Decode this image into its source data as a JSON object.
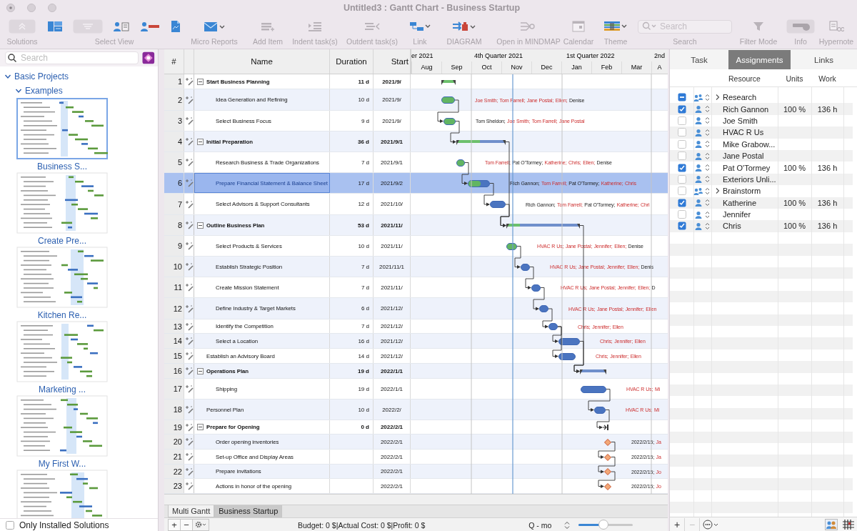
{
  "window": {
    "title": "Untitled3 : Gantt Chart - Business Startup"
  },
  "toolbar": [
    {
      "kind": "solutions",
      "label": "Solutions"
    },
    {
      "kind": "views",
      "label": "Select View"
    },
    {
      "kind": "reports",
      "label": "Micro Reports"
    },
    {
      "kind": "add",
      "label": "Add Item"
    },
    {
      "kind": "indent",
      "label": "Indent task(s)"
    },
    {
      "kind": "outdent",
      "label": "Outdent task(s)"
    },
    {
      "kind": "link",
      "label": "Link"
    },
    {
      "kind": "diagram",
      "label": "DIAGRAM"
    },
    {
      "kind": "mindmap",
      "label": "Open in MINDMAP"
    },
    {
      "kind": "calendar",
      "label": "Calendar"
    },
    {
      "kind": "theme",
      "label": "Theme"
    },
    {
      "kind": "search",
      "label": "Search",
      "placeholder": "Search"
    },
    {
      "kind": "filter",
      "label": "Filter Mode"
    },
    {
      "kind": "info",
      "label": "Info"
    },
    {
      "kind": "hypernote",
      "label": "Hypernote"
    }
  ],
  "sidebar": {
    "search": {
      "placeholder": "Search"
    },
    "tree": [
      {
        "label": "Basic Projects",
        "expanded": true,
        "children": [
          {
            "label": "Examples",
            "expanded": true
          }
        ]
      }
    ],
    "solutions": [
      {
        "label": "Business S...",
        "selected": true
      },
      {
        "label": "Create Pre...",
        "selected": false
      },
      {
        "label": "Kitchen Re...",
        "selected": false
      },
      {
        "label": "Marketing ...",
        "selected": false
      },
      {
        "label": "My First W...",
        "selected": false
      },
      {
        "selected": false
      }
    ],
    "only_installed": {
      "label": "Only Installed Solutions",
      "checked": false
    }
  },
  "gantt": {
    "columns": [
      "#",
      "Name",
      "Duration",
      "Start"
    ],
    "timeline": {
      "quarters": [
        "er 2021",
        "4th Quarter 2021",
        "1st Quarter 2022",
        "2nd"
      ],
      "months": [
        "Aug",
        "Sep",
        "Oct",
        "Nov",
        "Dec",
        "Jan",
        "Feb",
        "Mar",
        "A"
      ]
    },
    "rows": [
      {
        "num": "1",
        "name": "Start Business Planning",
        "kind": "summary",
        "expanded": true,
        "duration": "11 d",
        "start": "2021/9/",
        "level": 1,
        "selected": false,
        "children": [
          {
            "num": "2",
            "name": "Idea Generation and Refining",
            "kind": "task",
            "duration": "10 d",
            "start": "2021/9/",
            "level": 1,
            "selected": false,
            "resources": [
              {
                "name": "Joe Smith;",
                "overallocated": true
              },
              {
                "name": "Tom Farrell;",
                "overallocated": true
              },
              {
                "name": "Jane Postal;",
                "overallocated": true
              },
              {
                "name": "Ellen;",
                "overallocated": true
              },
              {
                "name": "Denise",
                "overallocated": false
              }
            ]
          },
          {
            "num": "3",
            "name": "Select Business Focus",
            "kind": "task",
            "duration": "9 d",
            "start": "2021/9/",
            "level": 1,
            "selected": false,
            "resources": [
              {
                "name": "Tom Sheldon;",
                "overallocated": false
              },
              {
                "name": "Joe Smith;",
                "overallocated": true
              },
              {
                "name": "Tom Farrell;",
                "overallocated": true
              },
              {
                "name": "Jane Postal",
                "overallocated": true
              }
            ]
          }
        ]
      },
      {
        "num": "4",
        "name": "Initial Preparation",
        "kind": "summary",
        "expanded": true,
        "duration": "36 d",
        "start": "2021/9/1",
        "level": 0.48,
        "selected": false,
        "children": [
          {
            "num": "5",
            "name": "Research Business & Trade Organizations",
            "kind": "task",
            "duration": "7 d",
            "start": "2021/9/1",
            "level": 1,
            "selected": false,
            "resources": [
              {
                "name": "Tom Farrell;",
                "overallocated": true
              },
              {
                "name": "Pat O'Tormey;",
                "overallocated": false
              },
              {
                "name": "Katherine;",
                "overallocated": true
              },
              {
                "name": "Chris;",
                "overallocated": true
              },
              {
                "name": "Ellen;",
                "overallocated": true
              },
              {
                "name": "Denise",
                "overallocated": false
              }
            ]
          },
          {
            "num": "6",
            "name": "Prepare Financial Statement & Balance Sheet",
            "kind": "task",
            "duration": "17 d",
            "start": "2021/9/2",
            "level": 0.6,
            "selected": true,
            "resources": [
              {
                "name": "Rich Gannon;",
                "overallocated": false
              },
              {
                "name": "Tom Farrell;",
                "overallocated": true
              },
              {
                "name": "Pat O'Tormey;",
                "overallocated": false
              },
              {
                "name": "Katherine;",
                "overallocated": true
              },
              {
                "name": "Chris",
                "overallocated": true
              }
            ]
          },
          {
            "num": "7",
            "name": "Select Advisors & Support Consultants",
            "kind": "task",
            "duration": "12 d",
            "start": "2021/10/",
            "level": 0,
            "selected": false,
            "resources": [
              {
                "name": "Rich Gannon;",
                "overallocated": false
              },
              {
                "name": "Tom Farrell;",
                "overallocated": true
              },
              {
                "name": "Pat O'Tormey;",
                "overallocated": false
              },
              {
                "name": "Katherine;",
                "overallocated": true
              },
              {
                "name": "Chri",
                "overallocated": true
              }
            ]
          }
        ]
      },
      {
        "num": "8",
        "name": "Outline Business Plan",
        "kind": "summary",
        "expanded": true,
        "duration": "53 d",
        "start": "2021/11/",
        "level": 0.18,
        "selected": false,
        "children": [
          {
            "num": "9",
            "name": "Select Products & Services",
            "kind": "task",
            "duration": "10 d",
            "start": "2021/11/",
            "level": 1,
            "selected": false,
            "resources": [
              {
                "name": "HVAC R Us;",
                "overallocated": true
              },
              {
                "name": "Jane Postal;",
                "overallocated": true
              },
              {
                "name": "Jennifer;",
                "overallocated": true
              },
              {
                "name": "Ellen;",
                "overallocated": true
              },
              {
                "name": "Denise",
                "overallocated": false
              }
            ]
          },
          {
            "num": "10",
            "name": "Establish Strategic Position",
            "kind": "task",
            "duration": "7 d",
            "start": "2021/11/1",
            "level": 0,
            "selected": false,
            "resources": [
              {
                "name": "HVAC R Us;",
                "overallocated": true
              },
              {
                "name": "Jane Postal;",
                "overallocated": true
              },
              {
                "name": "Jennifer;",
                "overallocated": true
              },
              {
                "name": "Ellen;",
                "overallocated": true
              },
              {
                "name": "Denis",
                "overallocated": false
              }
            ]
          },
          {
            "num": "11",
            "name": "Create Mission Statement",
            "kind": "task",
            "duration": "7 d",
            "start": "2021/11/",
            "level": 0,
            "selected": false,
            "resources": [
              {
                "name": "HVAC R Us;",
                "overallocated": true
              },
              {
                "name": "Jane Postal;",
                "overallocated": true
              },
              {
                "name": "Jennifer;",
                "overallocated": true
              },
              {
                "name": "Ellen;",
                "overallocated": true
              },
              {
                "name": "D",
                "overallocated": false
              }
            ]
          },
          {
            "num": "12",
            "name": "Define Industry & Target Markets",
            "kind": "task",
            "duration": "6 d",
            "start": "2021/12/",
            "level": 0,
            "selected": false,
            "resources": [
              {
                "name": "HVAC R Us;",
                "overallocated": true
              },
              {
                "name": "Jane Postal;",
                "overallocated": true
              },
              {
                "name": "Jennifer;",
                "overallocated": true
              },
              {
                "name": "Ellen",
                "overallocated": true
              }
            ]
          },
          {
            "num": "13",
            "name": "Identify the Competition",
            "kind": "task",
            "duration": "7 d",
            "start": "2021/12/",
            "level": 0,
            "selected": false,
            "resources": [
              {
                "name": "Chris;",
                "overallocated": true
              },
              {
                "name": "Jennifer;",
                "overallocated": true
              },
              {
                "name": "Ellen",
                "overallocated": true
              }
            ]
          },
          {
            "num": "14",
            "name": "Select a Location",
            "kind": "task",
            "duration": "16 d",
            "start": "2021/12/",
            "level": 0,
            "selected": false,
            "resources": [
              {
                "name": "Chris;",
                "overallocated": true
              },
              {
                "name": "Jennifer;",
                "overallocated": true
              },
              {
                "name": "Ellen",
                "overallocated": true
              }
            ]
          }
        ]
      },
      {
        "num": "15",
        "name": "Establish an Advisory Board",
        "kind": "task",
        "duration": "14 d",
        "start": "2021/12/",
        "level": 0,
        "selected": false,
        "resources": [
          {
            "name": "Chris;",
            "overallocated": true
          },
          {
            "name": "Jennifer;",
            "overallocated": true
          },
          {
            "name": "Ellen",
            "overallocated": true
          }
        ]
      },
      {
        "num": "16",
        "name": "Operations Plan",
        "kind": "summary",
        "expanded": true,
        "duration": "19 d",
        "start": "2022/1/1",
        "level": 0,
        "selected": false,
        "children": [
          {
            "num": "17",
            "name": "Shipping",
            "kind": "task",
            "duration": "19 d",
            "start": "2022/1/1",
            "level": 0,
            "selected": false,
            "resources": [
              {
                "name": "HVAC R Us;",
                "overallocated": true
              },
              {
                "name": "Mi",
                "overallocated": true
              }
            ]
          }
        ]
      },
      {
        "num": "18",
        "name": "Personnel Plan",
        "kind": "task",
        "duration": "10 d",
        "start": "2022/2/",
        "level": 0,
        "selected": false,
        "resources": [
          {
            "name": "HVAC R Us;",
            "overallocated": true
          },
          {
            "name": "Mi",
            "overallocated": true
          }
        ]
      },
      {
        "num": "19",
        "name": "Prepare for Opening",
        "kind": "summary",
        "expanded": true,
        "duration": "0 d",
        "start": "2022/2/1",
        "selected": false,
        "children": [
          {
            "num": "20",
            "name": "Order opening inventories",
            "kind": "milestone",
            "start": "2022/2/1",
            "selected": false,
            "resources": [
              {
                "name": "2022/2/15;",
                "overallocated": false
              },
              {
                "name": "Ja",
                "overallocated": true
              }
            ]
          },
          {
            "num": "21",
            "name": "Set-up Office and Display Areas",
            "kind": "milestone",
            "start": "2022/2/1",
            "selected": false,
            "resources": [
              {
                "name": "2022/2/15;",
                "overallocated": false
              },
              {
                "name": "Ja",
                "overallocated": true
              }
            ]
          },
          {
            "num": "22",
            "name": "Prepare invitations",
            "kind": "milestone",
            "start": "2022/2/1",
            "selected": false,
            "resources": [
              {
                "name": "2022/2/15;",
                "overallocated": false
              },
              {
                "name": "Jo",
                "overallocated": true
              }
            ]
          },
          {
            "num": "23",
            "name": "Actions in honor of the opening",
            "kind": "milestone",
            "start": "2022/2/1",
            "selected": false,
            "resources": [
              {
                "name": "2022/2/15;",
                "overallocated": false
              },
              {
                "name": "Jo",
                "overallocated": true
              }
            ]
          }
        ]
      }
    ],
    "sheet_tabs": [
      {
        "label": "Multi Gantt",
        "selected": false
      },
      {
        "label": "Business Startup",
        "selected": true
      }
    ],
    "status_bar": {
      "buttons": [
        "+",
        "−"
      ],
      "totals": "Budget: 0 $|Actual Cost: 0 $|Profit: 0 $",
      "scale": "Q - mo",
      "zoom": {
        "level": 0.45
      }
    }
  },
  "assignments_panel": {
    "tabs": [
      {
        "label": "Task",
        "selected": false
      },
      {
        "label": "Assignments",
        "selected": true
      },
      {
        "label": "Links",
        "selected": false
      }
    ],
    "columns": [
      "Resource",
      "Units",
      "Work"
    ],
    "resources": [
      {
        "kind": "group",
        "name": "Research",
        "checked": true,
        "indeterminate": true,
        "expanded": false
      },
      {
        "kind": "person",
        "name": "Rich Gannon",
        "checked": true,
        "indeterminate": false,
        "units": "100 %",
        "work": "136 h"
      },
      {
        "kind": "person",
        "name": "Joe Smith",
        "checked": false,
        "indeterminate": false
      },
      {
        "kind": "person",
        "name": "HVAC R Us",
        "checked": false,
        "indeterminate": false
      },
      {
        "kind": "person",
        "name": "Mike Grabow...",
        "checked": false,
        "indeterminate": false
      },
      {
        "kind": "person",
        "name": "Jane Postal",
        "checked": false,
        "indeterminate": false
      },
      {
        "kind": "person",
        "name": "Pat O'Tormey",
        "checked": true,
        "indeterminate": false,
        "units": "100 %",
        "work": "136 h"
      },
      {
        "kind": "person",
        "name": "Exteriors Unli...",
        "checked": false,
        "indeterminate": false
      },
      {
        "kind": "group",
        "name": "Brainstorm",
        "checked": false,
        "indeterminate": false,
        "expanded": false
      },
      {
        "kind": "person",
        "name": "Katherine",
        "checked": true,
        "indeterminate": false,
        "units": "100 %",
        "work": "136 h"
      },
      {
        "kind": "person",
        "name": "Jennifer",
        "checked": false,
        "indeterminate": false
      },
      {
        "kind": "person",
        "name": "Chris",
        "checked": true,
        "indeterminate": false,
        "units": "100 %",
        "work": "136 h"
      }
    ],
    "buttons": [
      {
        "label": "+",
        "disabled": false
      },
      {
        "label": "−",
        "disabled": true
      }
    ]
  }
}
